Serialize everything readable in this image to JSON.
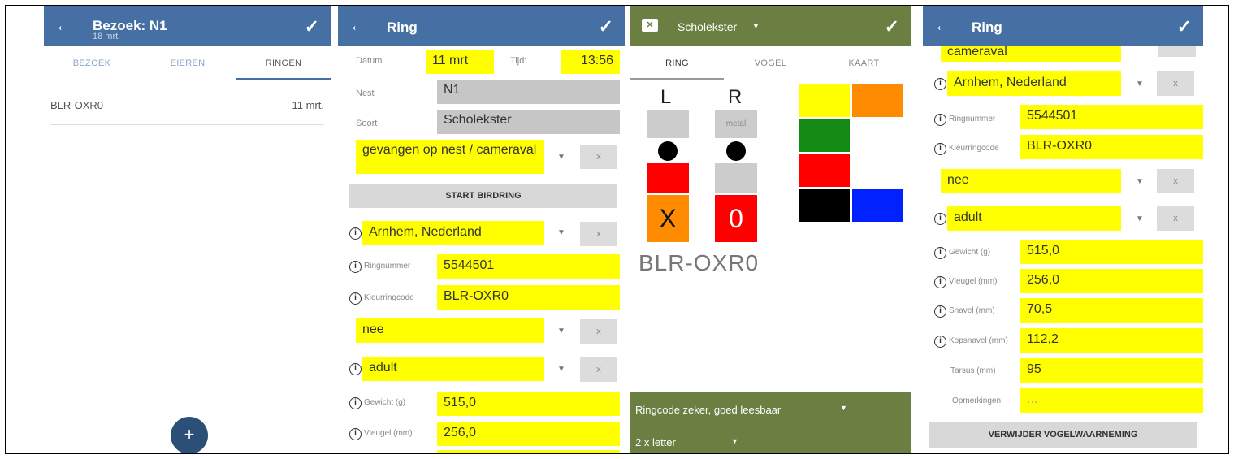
{
  "screen1": {
    "title": "Bezoek: N1",
    "subtitle": "18 mrt.",
    "back": "←",
    "check": "✓",
    "tabs": [
      "BEZOEK",
      "EIEREN",
      "RINGEN"
    ],
    "row_code": "BLR-OXR0",
    "row_date": "11 mrt.",
    "fab": "+"
  },
  "screen2": {
    "title": "Ring",
    "back": "←",
    "check": "✓",
    "datum_label": "Datum",
    "datum_value": "11 mrt",
    "tijd_label": "Tijd:",
    "tijd_value": "13:56",
    "nest_label": "Nest",
    "nest_value": "N1",
    "soort_label": "Soort",
    "soort_value": "Scholekster",
    "method_value": "gevangen op nest / cameraval",
    "x": "x",
    "start_button": "START BIRDRING",
    "location_value": "Arnhem, Nederland",
    "ringnummer_label": "Ringnummer",
    "ringnummer_value": "5544501",
    "kleurringcode_label": "Kleurringcode",
    "kleurringcode_value": "BLR-OXR0",
    "nee_value": "nee",
    "adult_value": "adult",
    "gewicht_label": "Gewicht (g)",
    "gewicht_value": "515,0",
    "vleugel_label": "Vleugel (mm)",
    "vleugel_value": "256,0"
  },
  "screen3": {
    "species": "Scholekster",
    "check": "✓",
    "tabs": [
      "RING",
      "VOGEL",
      "KAART"
    ],
    "left_label": "L",
    "right_label": "R",
    "metal": "metal",
    "left_ring_letter": "X",
    "right_ring_letter": "0",
    "code": "BLR-OXR0",
    "readability": "Ringcode zeker, goed leesbaar",
    "letter_count": "2 x letter",
    "colors": {
      "yellow": "#ffff00",
      "orange": "#ff8c00",
      "green": "#138a13",
      "white": "#ffffff",
      "red": "#ff0000",
      "black": "#000000",
      "blue": "#0022ff",
      "gray": "#cccccc",
      "bottom_bar": "#6b7f42"
    }
  },
  "screen4": {
    "title": "Ring",
    "back": "←",
    "check": "✓",
    "top_value": "cameraval",
    "x": "x",
    "location_value": "Arnhem, Nederland",
    "ringnummer_label": "Ringnummer",
    "ringnummer_value": "5544501",
    "kleurringcode_label": "Kleurringcode",
    "kleurringcode_value": "BLR-OXR0",
    "nee_value": "nee",
    "adult_value": "adult",
    "gewicht_label": "Gewicht (g)",
    "gewicht_value": "515,0",
    "vleugel_label": "Vleugel (mm)",
    "vleugel_value": "256,0",
    "snavel_label": "Snavel (mm)",
    "snavel_value": "70,5",
    "kopsnavel_label": "Kopsnavel (mm)",
    "kopsnavel_value": "112,2",
    "tarsus_label": "Tarsus (mm)",
    "tarsus_value": "95",
    "opmerkingen_label": "Opmerkingen",
    "opmerkingen_placeholder": "...",
    "delete_button": "VERWIJDER VOGELWAARNEMING"
  }
}
